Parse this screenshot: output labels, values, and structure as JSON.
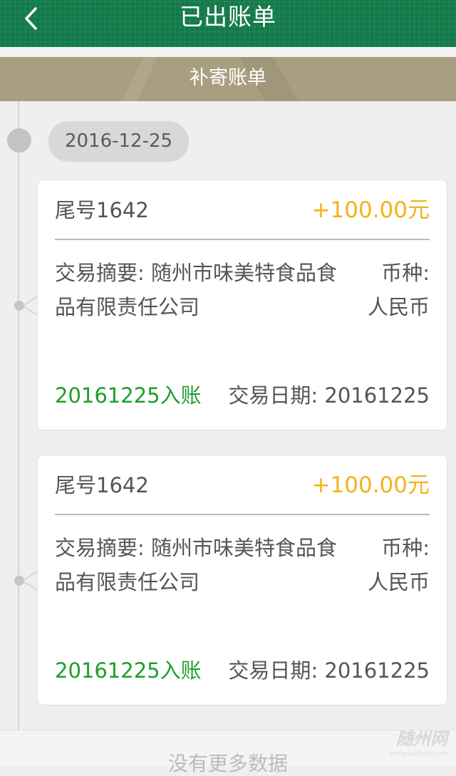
{
  "header": {
    "title": "已出账单",
    "back_icon": "chevron-left-icon"
  },
  "subheader": {
    "label": "补寄账单"
  },
  "timeline": {
    "date": "2016-12-25",
    "records": [
      {
        "tail": "尾号1642",
        "amount": "+100.00元",
        "summary": "交易摘要: 随州市味美特食品食品有限责任公司",
        "currency": "币种: 人民币",
        "posted": "20161225入账",
        "trade_date": "交易日期: 20161225"
      },
      {
        "tail": "尾号1642",
        "amount": "+100.00元",
        "summary": "交易摘要: 随州市味美特食品食品有限责任公司",
        "currency": "币种: 人民币",
        "posted": "20161225入账",
        "trade_date": "交易日期: 20161225"
      }
    ]
  },
  "footer": {
    "no_more": "没有更多数据",
    "watermark": "随州网",
    "watermark_sub": "www.suizhou.com"
  },
  "colors": {
    "header_green": "#137a4a",
    "subheader_khaki": "#a99f80",
    "amount_orange": "#f3b21b",
    "posted_green": "#1e9e2b"
  }
}
